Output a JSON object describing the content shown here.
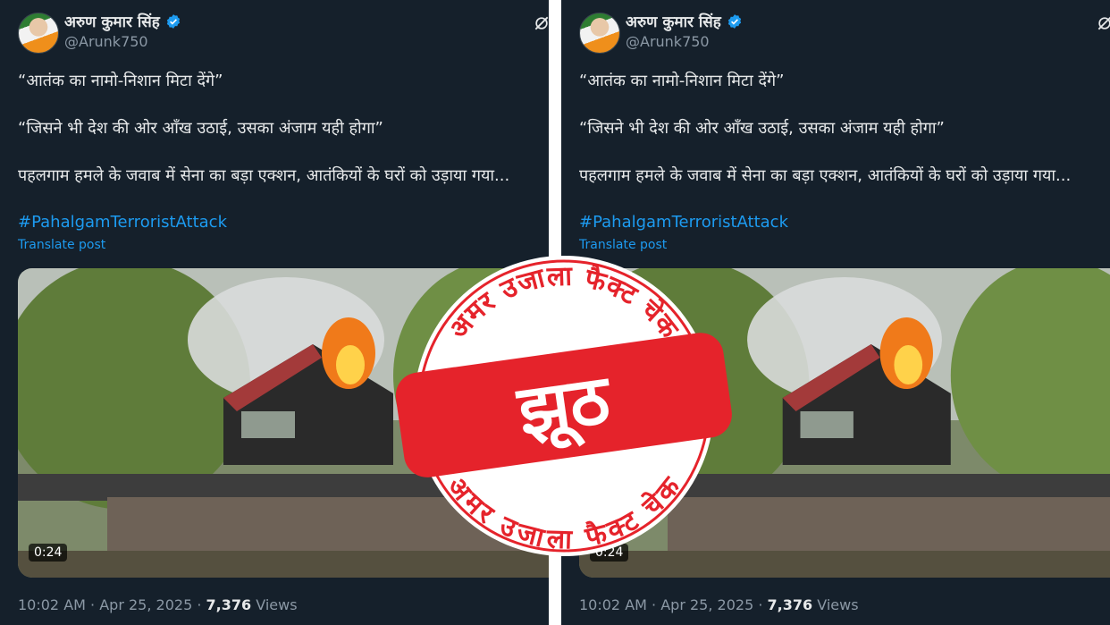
{
  "tweet": {
    "author_name": "अरुण कुमार सिंह",
    "handle": "@Arunk750",
    "line1": "“आतंक का नामो-निशान मिटा देंगे”",
    "line2": "“जिसने भी देश की ओर आँख उठाई, उसका अंजाम यही होगा”",
    "line3": "पहलगाम हमले के जवाब में सेना का बड़ा एक्शन, आतंकियों के घरों को उड़ाया गया...",
    "hashtag": "#PahalgamTerroristAttack",
    "translate_label": "Translate post",
    "video_duration": "0:24",
    "time": "10:02 AM",
    "date": "Apr 25, 2025",
    "views_count": "7,376",
    "views_label": "Views",
    "sep": "·"
  },
  "stamp": {
    "top_text": "अमर उजाला फैक्ट चेक",
    "center_text": "झूठ",
    "bottom_text": "अमर उजाला फैक्ट चेक"
  },
  "colors": {
    "background": "#15202b",
    "link": "#1d9bf0",
    "muted": "#8b98a5",
    "stamp_red": "#e5232b"
  },
  "icons": [
    "verified-badge-icon",
    "grok-icon"
  ]
}
